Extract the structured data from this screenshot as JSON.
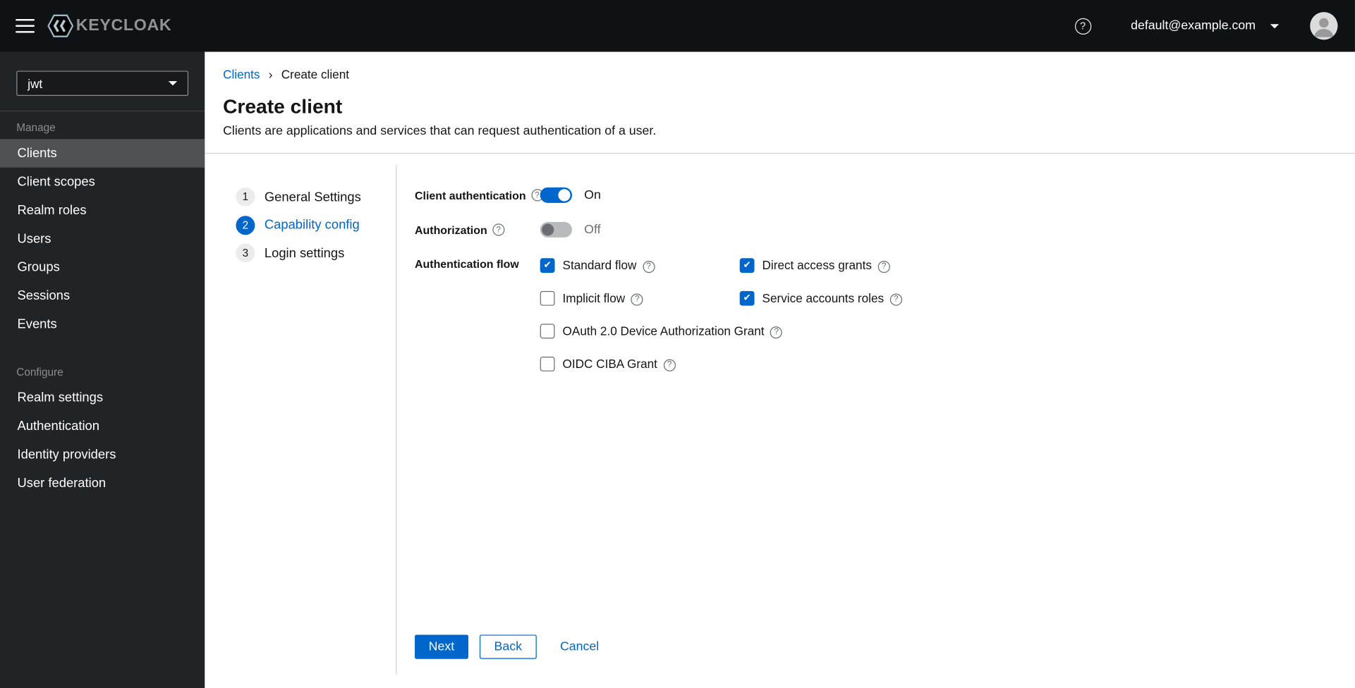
{
  "colors": {
    "accent": "#0066cc",
    "masthead": "#0f1214",
    "sidebar": "#212427",
    "selected_nav": "#4f5255"
  },
  "icons": {
    "help": "?",
    "hamburger": "menu-bars",
    "user_caret": "caret-down",
    "breadcrumb_separator": "›",
    "check": "✔"
  },
  "topbar": {
    "brand": "KEYCLOAK",
    "user_email": "default@example.com"
  },
  "sidebar": {
    "realm": "jwt",
    "sections": [
      {
        "label": "Manage",
        "items": [
          {
            "label": "Clients",
            "selected": true
          },
          {
            "label": "Client scopes",
            "selected": false
          },
          {
            "label": "Realm roles",
            "selected": false
          },
          {
            "label": "Users",
            "selected": false
          },
          {
            "label": "Groups",
            "selected": false
          },
          {
            "label": "Sessions",
            "selected": false
          },
          {
            "label": "Events",
            "selected": false
          }
        ]
      },
      {
        "label": "Configure",
        "items": [
          {
            "label": "Realm settings",
            "selected": false
          },
          {
            "label": "Authentication",
            "selected": false
          },
          {
            "label": "Identity providers",
            "selected": false
          },
          {
            "label": "User federation",
            "selected": false
          }
        ]
      }
    ]
  },
  "breadcrumb": {
    "link": "Clients",
    "current": "Create client"
  },
  "page": {
    "title": "Create client",
    "subtitle": "Clients are applications and services that can request authentication of a user."
  },
  "wizard": {
    "steps": [
      {
        "number": "1",
        "label": "General Settings",
        "active": false
      },
      {
        "number": "2",
        "label": "Capability config",
        "active": true
      },
      {
        "number": "3",
        "label": "Login settings",
        "active": false
      }
    ]
  },
  "form": {
    "client_authentication": {
      "label": "Client authentication",
      "state": "On",
      "on": true
    },
    "authorization": {
      "label": "Authorization",
      "state": "Off",
      "on": false
    },
    "authentication_flow": {
      "label": "Authentication flow",
      "options": [
        {
          "label": "Standard flow",
          "checked": true
        },
        {
          "label": "Direct access grants",
          "checked": true
        },
        {
          "label": "Implicit flow",
          "checked": false
        },
        {
          "label": "Service accounts roles",
          "checked": true
        },
        {
          "label": "OAuth 2.0 Device Authorization Grant",
          "checked": false
        },
        {
          "label": "OIDC CIBA Grant",
          "checked": false
        }
      ]
    }
  },
  "footer": {
    "next": "Next",
    "back": "Back",
    "cancel": "Cancel"
  }
}
